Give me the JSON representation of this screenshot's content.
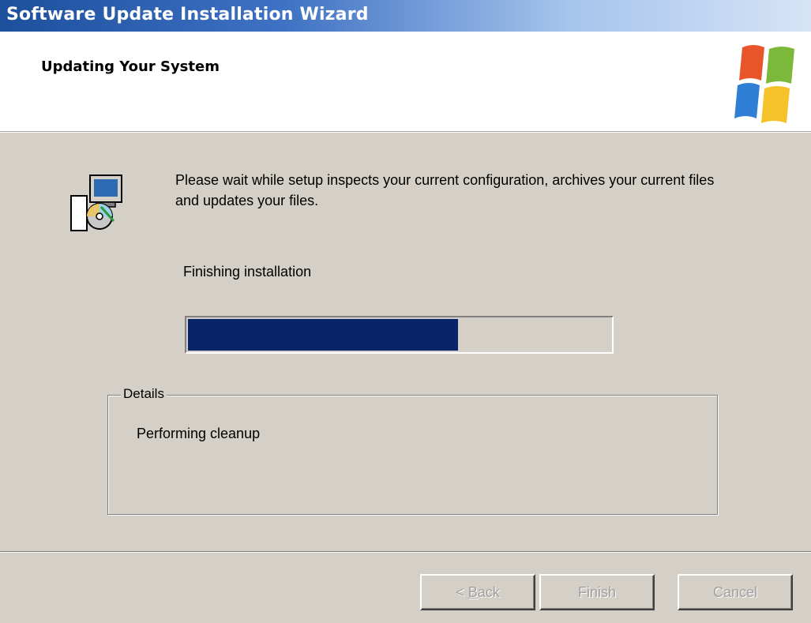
{
  "window": {
    "title": "Software Update Installation Wizard"
  },
  "header": {
    "title": "Updating Your System",
    "logo_icon": "windows-flag-logo"
  },
  "main": {
    "icon": "setup-computer-cd-icon",
    "description": "Please wait while setup inspects your current configuration, archives your current files and updates your files.",
    "status": "Finishing installation",
    "progress": 0.64,
    "progress_color": "#0a246a",
    "details": {
      "legend": "Details",
      "text": "Performing cleanup"
    }
  },
  "footer": {
    "back_prefix": "< ",
    "back_mnemonic": "B",
    "back_rest": "ack",
    "finish_label": "Finish",
    "cancel_label": "Cancel"
  }
}
